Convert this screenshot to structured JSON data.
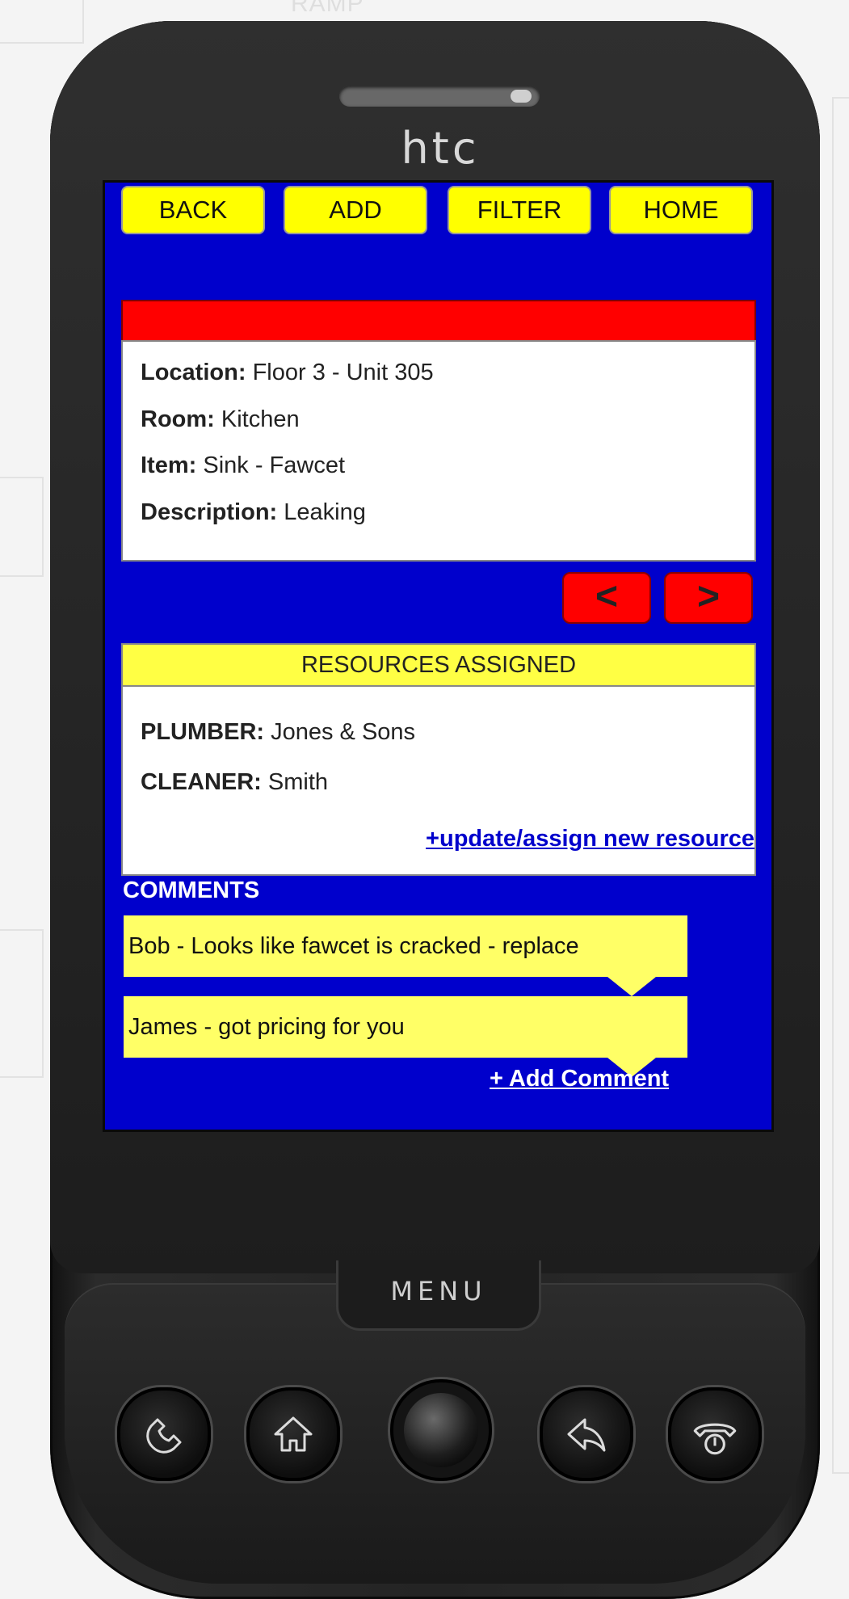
{
  "background": {
    "label": "RAMP"
  },
  "device": {
    "brand": "htc",
    "menu_label": "MENU"
  },
  "toolbar": {
    "back": "BACK",
    "add": "ADD",
    "filter": "FILTER",
    "home": "HOME"
  },
  "issue": {
    "location_label": "Location:",
    "location": "Floor 3 - Unit 305",
    "room_label": "Room:",
    "room": "Kitchen",
    "item_label": "Item:",
    "item": "Sink - Fawcet",
    "description_label": "Description:",
    "description": "Leaking"
  },
  "pager": {
    "prev": "<",
    "next": ">"
  },
  "resources": {
    "title": "RESOURCES ASSIGNED",
    "items": [
      {
        "role": "PLUMBER:",
        "name": "Jones & Sons"
      },
      {
        "role": "CLEANER:",
        "name": "Smith"
      }
    ],
    "update_link": "+update/assign new resource"
  },
  "comments": {
    "title": "COMMENTS",
    "items": [
      "Bob - Looks like fawcet is cracked - replace",
      "James - got pricing for you"
    ],
    "add_link": "+ Add Comment"
  },
  "colors": {
    "screen_bg": "#0000cc",
    "button_yellow": "#ffff00",
    "status_red": "#ff0000",
    "comment_yellow": "#ffff66"
  },
  "icons": [
    "phone-icon",
    "home-icon",
    "back-arrow-icon",
    "end-call-icon",
    "trackball"
  ]
}
